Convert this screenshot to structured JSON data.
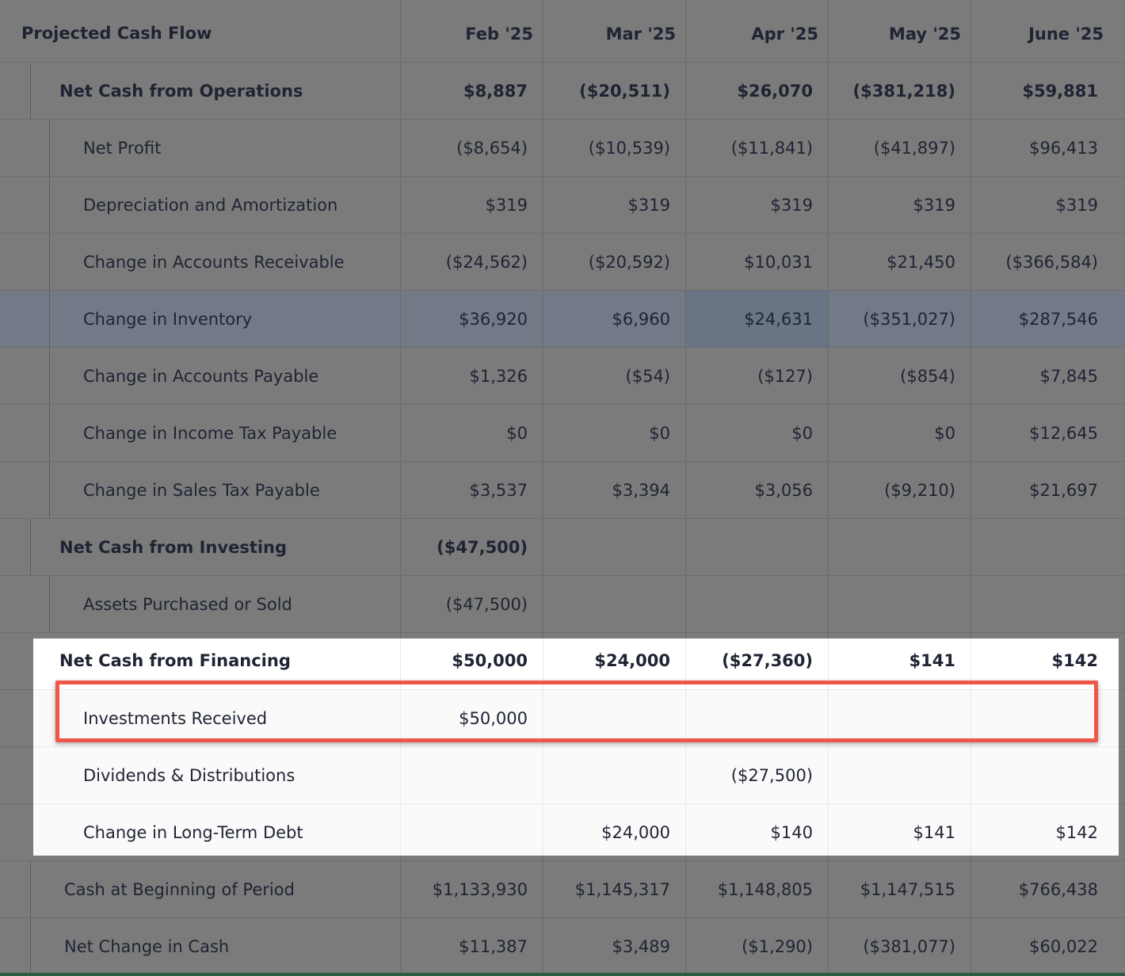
{
  "header": {
    "title": "Projected Cash Flow",
    "months": [
      "Feb '25",
      "Mar '25",
      "Apr '25",
      "May '25",
      "June '25"
    ]
  },
  "rows": [
    {
      "label": "Net Cash from Operations",
      "kind": "section",
      "values": [
        "$8,887",
        "($20,511)",
        "$26,070",
        "($381,218)",
        "$59,881"
      ]
    },
    {
      "label": "Net Profit",
      "kind": "sub",
      "values": [
        "($8,654)",
        "($10,539)",
        "($11,841)",
        "($41,897)",
        "$96,413"
      ]
    },
    {
      "label": "Depreciation and Amortization",
      "kind": "sub",
      "values": [
        "$319",
        "$319",
        "$319",
        "$319",
        "$319"
      ]
    },
    {
      "label": "Change in Accounts Receivable",
      "kind": "sub",
      "values": [
        "($24,562)",
        "($20,592)",
        "$10,031",
        "$21,450",
        "($366,584)"
      ]
    },
    {
      "label": "Change in Inventory",
      "kind": "sub",
      "values": [
        "$36,920",
        "$6,960",
        "$24,631",
        "($351,027)",
        "$287,546"
      ]
    },
    {
      "label": "Change in Accounts Payable",
      "kind": "sub",
      "values": [
        "$1,326",
        "($54)",
        "($127)",
        "($854)",
        "$7,845"
      ]
    },
    {
      "label": "Change in Income Tax Payable",
      "kind": "sub",
      "values": [
        "$0",
        "$0",
        "$0",
        "$0",
        "$12,645"
      ]
    },
    {
      "label": "Change in Sales Tax Payable",
      "kind": "sub",
      "values": [
        "$3,537",
        "$3,394",
        "$3,056",
        "($9,210)",
        "$21,697"
      ]
    },
    {
      "label": "Net Cash from Investing",
      "kind": "section",
      "values": [
        "($47,500)",
        "",
        "",
        "",
        ""
      ]
    },
    {
      "label": "Assets Purchased or Sold",
      "kind": "sub",
      "values": [
        "($47,500)",
        "",
        "",
        "",
        ""
      ]
    },
    {
      "label": "Net Cash from Financing",
      "kind": "section",
      "values": [
        "$50,000",
        "$24,000",
        "($27,360)",
        "$141",
        "$142"
      ]
    },
    {
      "label": "Investments Received",
      "kind": "sub",
      "values": [
        "$50,000",
        "",
        "",
        "",
        ""
      ]
    },
    {
      "label": "Dividends & Distributions",
      "kind": "sub",
      "values": [
        "",
        "",
        "($27,500)",
        "",
        ""
      ]
    },
    {
      "label": "Change in Long-Term Debt",
      "kind": "sub",
      "values": [
        "",
        "$24,000",
        "$140",
        "$141",
        "$142"
      ]
    },
    {
      "label": "Cash at Beginning of Period",
      "kind": "total",
      "values": [
        "$1,133,930",
        "$1,145,317",
        "$1,148,805",
        "$1,147,515",
        "$766,438"
      ]
    },
    {
      "label": "Net Change in Cash",
      "kind": "total",
      "values": [
        "$11,387",
        "$3,489",
        "($1,290)",
        "($381,077)",
        "$60,022"
      ]
    }
  ],
  "colors": {
    "overlay": "#7b7b7b",
    "highlight_border": "#f0574a",
    "spotlight": "#ffffff"
  }
}
